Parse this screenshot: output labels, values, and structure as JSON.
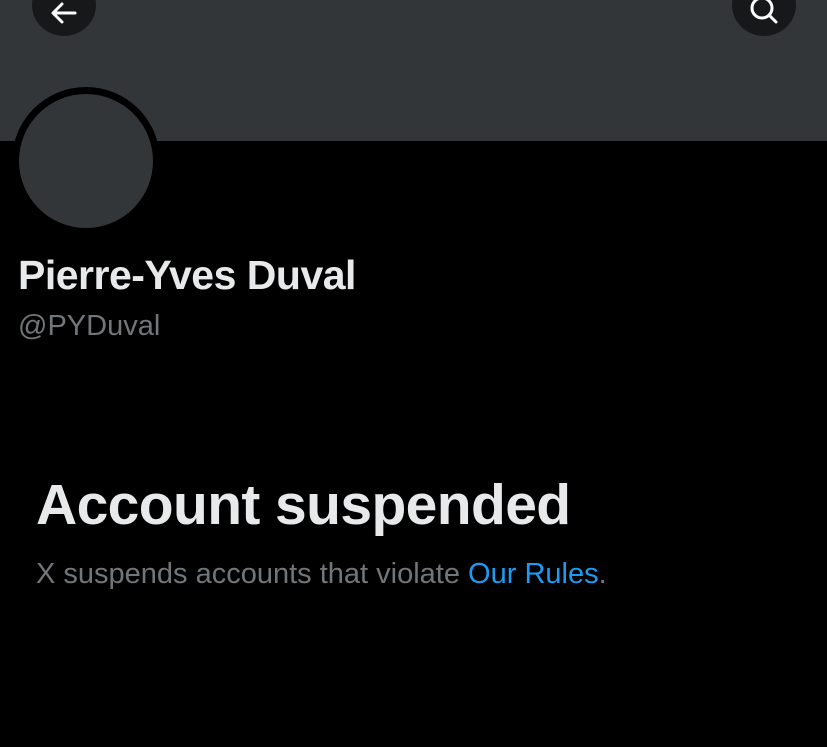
{
  "header": {
    "back_icon": "arrow-left-icon",
    "search_icon": "search-icon"
  },
  "profile": {
    "display_name": "Pierre-Yves Duval",
    "handle": "@PYDuval"
  },
  "suspension": {
    "title": "Account suspended",
    "description": "X suspends accounts that violate ",
    "link_text": "Our Rules",
    "trailing": "."
  },
  "colors": {
    "background": "#000000",
    "banner": "#333639",
    "primary_text": "#e7e9ea",
    "secondary_text": "#71767b",
    "link": "#1d9bf0"
  }
}
